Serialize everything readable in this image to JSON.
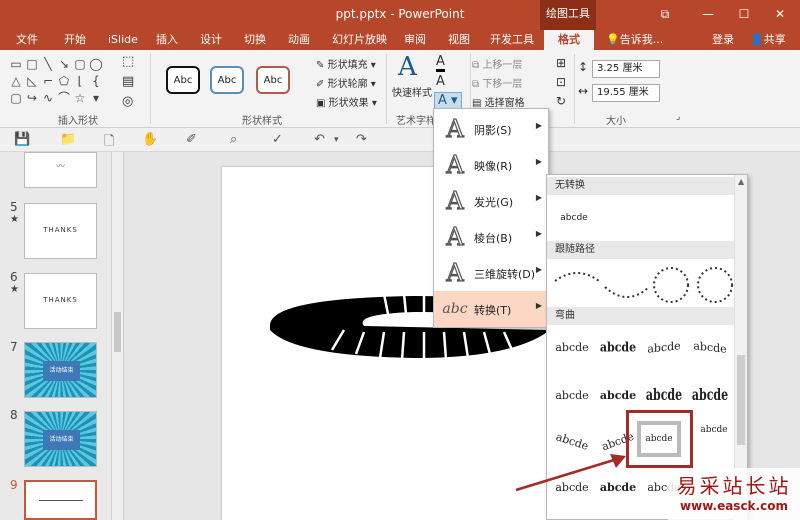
{
  "window": {
    "title": "ppt.pptx - PowerPoint",
    "contextual_tool": "绘图工具",
    "controls": [
      "⧉",
      "—",
      "☐",
      "✕"
    ]
  },
  "tabs": [
    {
      "label": "文件"
    },
    {
      "label": "开始"
    },
    {
      "label": "iSlide"
    },
    {
      "label": "插入"
    },
    {
      "label": "设计"
    },
    {
      "label": "切换"
    },
    {
      "label": "动画"
    },
    {
      "label": "幻灯片放映"
    },
    {
      "label": "审阅"
    },
    {
      "label": "视图"
    },
    {
      "label": "开发工具"
    },
    {
      "label": "格式"
    }
  ],
  "tellme": "告诉我...",
  "login": "登录",
  "share": "共享",
  "ribbon": {
    "groups": {
      "insert_shapes": "插入形状",
      "shape_styles": "形状样式",
      "art_styles": "艺术字样",
      "size": "大小"
    },
    "style_sample": "Abc",
    "shape_fill": "形状填充",
    "shape_outline": "形状轮廓",
    "shape_effects": "形状效果",
    "quick_styles": "快速样式",
    "bring_forward": "上移一层",
    "send_backward": "下移一层",
    "selection_pane": "选择窗格",
    "height": "3.25 厘米",
    "width": "19.55 厘米"
  },
  "slides": [
    {
      "num": "5",
      "star": "★",
      "text": "THANKS"
    },
    {
      "num": "6",
      "star": "★",
      "text": "THANKS"
    },
    {
      "num": "7",
      "text": "活动结束"
    },
    {
      "num": "8",
      "text": "活动结束"
    },
    {
      "num": "9"
    }
  ],
  "text_effects_menu": [
    {
      "label": "阴影(S)"
    },
    {
      "label": "映像(R)"
    },
    {
      "label": "发光(G)"
    },
    {
      "label": "棱台(B)"
    },
    {
      "label": "三维旋转(D)"
    },
    {
      "label": "转换(T)"
    }
  ],
  "transform_gallery": {
    "no_transform": "无转换",
    "no_transform_sample": "abcde",
    "follow_path": "跟随路径",
    "warp": "弯曲",
    "sample": "abcde"
  },
  "watermark": {
    "line1": "易采站长站",
    "line2": "www.easck.com"
  },
  "colors": {
    "accent": "#b7472a",
    "menu_highlight": "#fcd7c4",
    "callout": "#a52a2a"
  }
}
